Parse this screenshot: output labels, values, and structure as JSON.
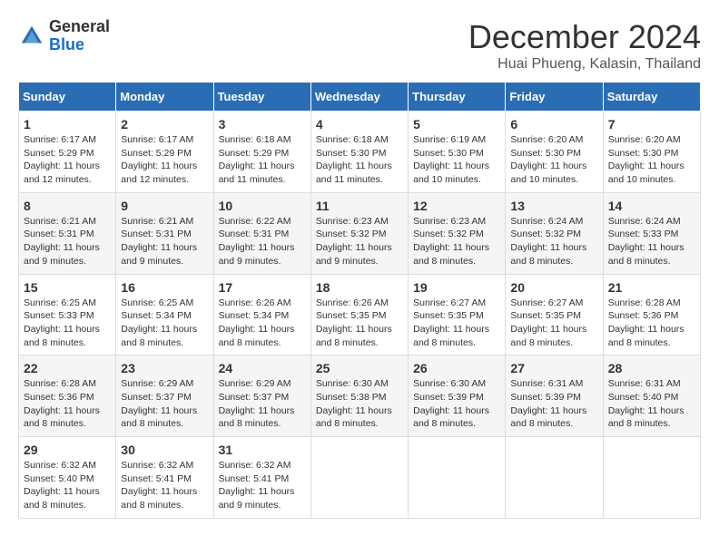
{
  "logo": {
    "general": "General",
    "blue": "Blue"
  },
  "title": {
    "month_year": "December 2024",
    "location": "Huai Phueng, Kalasin, Thailand"
  },
  "calendar": {
    "headers": [
      "Sunday",
      "Monday",
      "Tuesday",
      "Wednesday",
      "Thursday",
      "Friday",
      "Saturday"
    ],
    "weeks": [
      [
        null,
        null,
        null,
        null,
        null,
        null,
        null
      ]
    ]
  },
  "days": {
    "w1": [
      {
        "num": "",
        "info": ""
      },
      {
        "num": "",
        "info": ""
      },
      {
        "num": "",
        "info": ""
      },
      {
        "num": "",
        "info": ""
      },
      {
        "num": "",
        "info": ""
      },
      {
        "num": "",
        "info": ""
      },
      {
        "num": "",
        "info": ""
      }
    ]
  }
}
